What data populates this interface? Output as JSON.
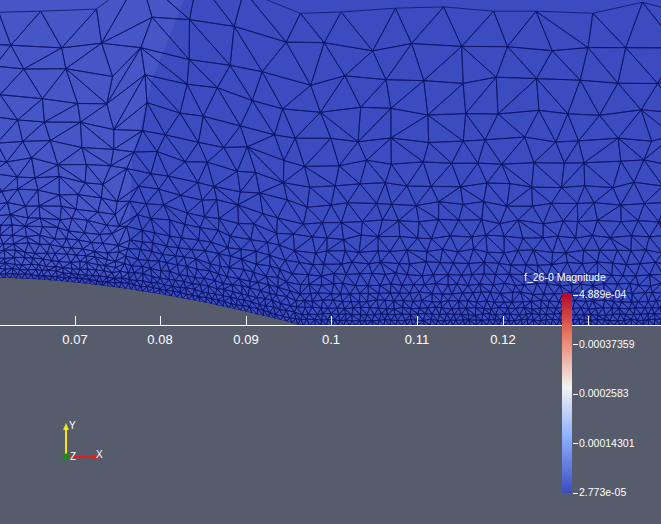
{
  "axis": {
    "ticks": [
      "0.07",
      "0.08",
      "0.09",
      "0.1",
      "0.11",
      "0.12"
    ]
  },
  "legend": {
    "title": "f_26-0 Magnitude",
    "labels": [
      "4.889e-04",
      "0.00037359",
      "0.0002583",
      "0.00014301",
      "2.773e-05"
    ]
  },
  "triad": {
    "x": "X",
    "y": "Y",
    "z": "Z"
  }
}
